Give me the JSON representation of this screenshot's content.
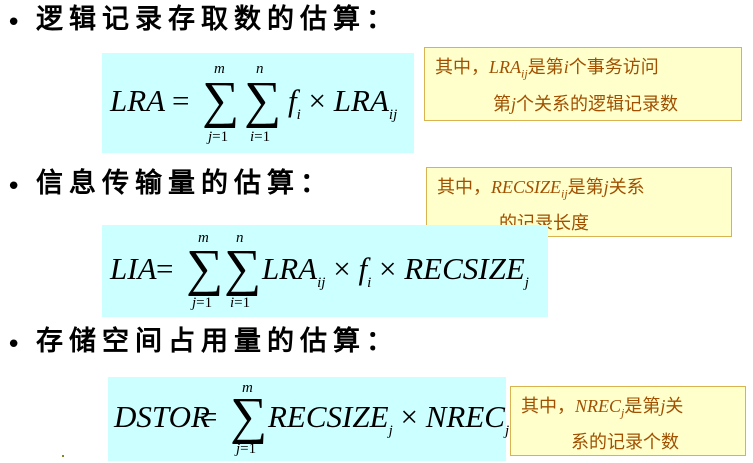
{
  "sections": [
    {
      "heading": "逻辑记录存取数的估算：",
      "formula": {
        "lhs": "LRA",
        "eq": "=",
        "sum1": {
          "sym": "∑",
          "top": "m",
          "bottom_var": "j",
          "bottom_rest": "=1"
        },
        "sum2": {
          "sym": "∑",
          "top": "n",
          "bottom_var": "i",
          "bottom_rest": "=1"
        },
        "t1": "f",
        "t1_sub": "i",
        "times1": "×",
        "t2": "LRA",
        "t2_sub": "ij"
      },
      "note": {
        "prefix": "其中，",
        "var": "LRA",
        "var_sub": "ij",
        "mid": "是第",
        "idx": "i",
        "suffix": "个事务访问",
        "line2_pre": "第",
        "line2_idx": "j",
        "line2_post": "个关系的逻辑记录数"
      }
    },
    {
      "heading": "信息传输量的估算：",
      "formula": {
        "lhs": "LIA",
        "eq": "=",
        "sum1": {
          "sym": "∑",
          "top": "m",
          "bottom_var": "j",
          "bottom_rest": "=1"
        },
        "sum2": {
          "sym": "∑",
          "top": "n",
          "bottom_var": "i",
          "bottom_rest": "=1"
        },
        "t1": "LRA",
        "t1_sub": "ij",
        "times1": "×",
        "t2": "f",
        "t2_sub": "i",
        "times2": "×",
        "t3": "RECSIZE",
        "t3_sub": "j"
      },
      "note": {
        "prefix": "其中，",
        "var": "RECSIZE",
        "var_sub": "ij",
        "mid": "是第",
        "idx": "j",
        "suffix": "关系",
        "line2": "的记录长度"
      }
    },
    {
      "heading": "存储空间占用量的估算：",
      "formula": {
        "lhs": "DSTOR",
        "eq": "=",
        "sum1": {
          "sym": "∑",
          "top": "m",
          "bottom_var": "j",
          "bottom_rest": "=1"
        },
        "t1": "RECSIZE",
        "t1_sub": "j",
        "times1": "×",
        "t2": "NREC",
        "t2_sub": "j"
      },
      "note": {
        "prefix": "其中，",
        "var": "NREC",
        "var_sub": "j",
        "mid": "是第",
        "idx": "j",
        "suffix": "关",
        "line2": "系的记录个数"
      }
    }
  ],
  "bullet": "•"
}
